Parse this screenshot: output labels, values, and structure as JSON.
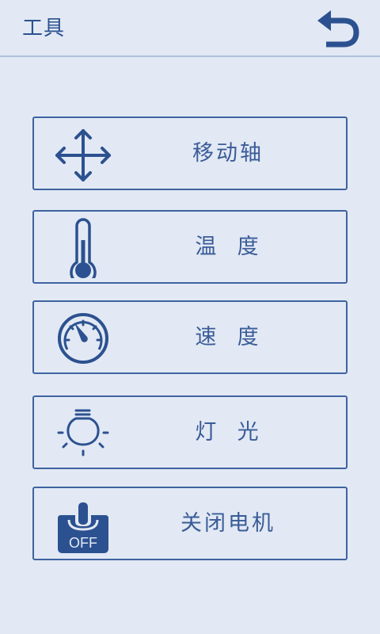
{
  "header": {
    "title": "工具",
    "back_icon": "undo-arrow-icon"
  },
  "colors": {
    "background": "#e2e9f4",
    "accent": "#2c5190",
    "border": "#3f63a0",
    "divider": "#aebfd9"
  },
  "menu": {
    "items": [
      {
        "label": "移动轴",
        "icon": "move-arrows-icon"
      },
      {
        "label": "温  度",
        "icon": "thermometer-icon"
      },
      {
        "label": "速  度",
        "icon": "speedometer-icon"
      },
      {
        "label": "灯  光",
        "icon": "light-bulb-icon"
      },
      {
        "label": "关闭电机",
        "icon": "motor-off-icon",
        "icon_text": "OFF"
      }
    ]
  }
}
